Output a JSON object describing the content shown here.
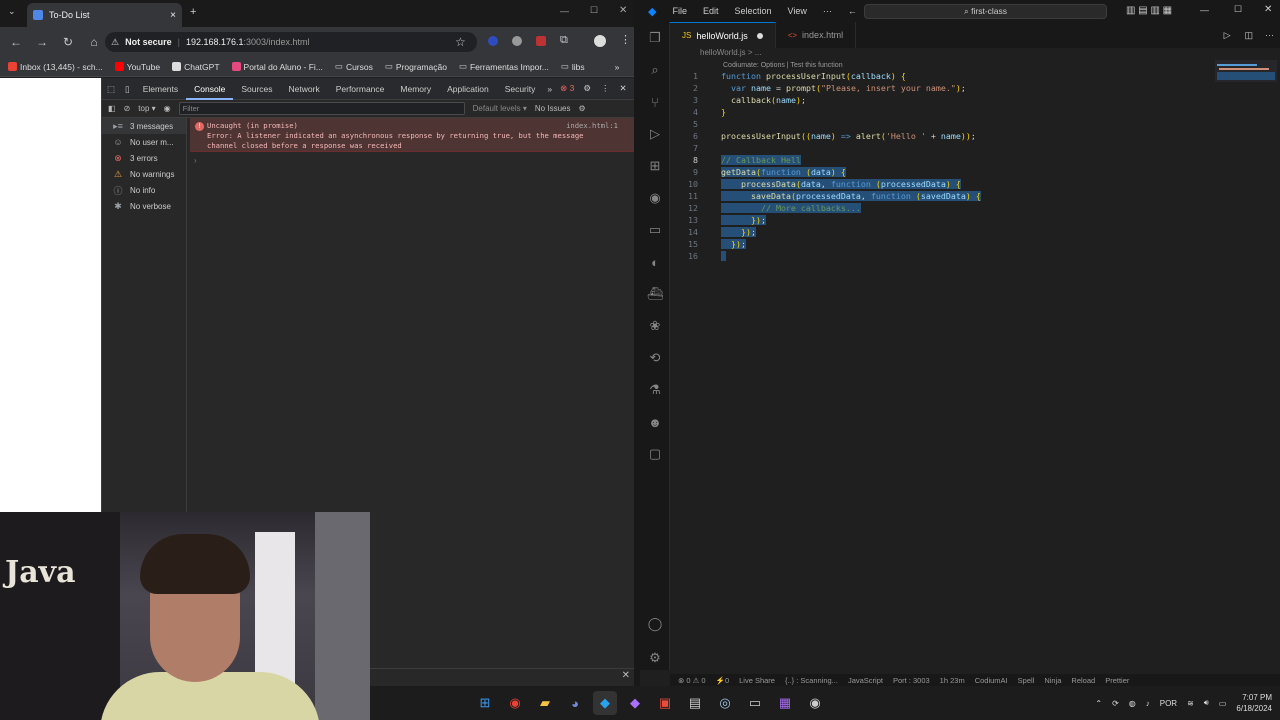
{
  "browser": {
    "tab_title": "To-Do List",
    "security_label": "Not secure",
    "url_host": "192.168.176.1",
    "url_rest": ":3003/index.html",
    "bookmarks": [
      "Inbox (13,445) - sch...",
      "YouTube",
      "ChatGPT",
      "Portal do Aluno - Fi...",
      "Cursos",
      "Programação",
      "Ferramentas Impor...",
      "libs"
    ]
  },
  "devtools": {
    "tabs": [
      "Elements",
      "Console",
      "Sources",
      "Network",
      "Performance",
      "Memory",
      "Application",
      "Security"
    ],
    "active_tab": "Console",
    "issue_count": "3",
    "context": "top",
    "filter_placeholder": "Filter",
    "levels": "Default levels",
    "issues": "No Issues",
    "sidebar": [
      {
        "label": "3 messages",
        "icon": "list-icon",
        "color": "#9aa0a6"
      },
      {
        "label": "No user m...",
        "icon": "user-icon",
        "color": "#9aa0a6"
      },
      {
        "label": "3 errors",
        "icon": "error-icon",
        "color": "#e46962"
      },
      {
        "label": "No warnings",
        "icon": "warning-icon",
        "color": "#f2a541"
      },
      {
        "label": "No info",
        "icon": "info-icon",
        "color": "#9aa0a6"
      },
      {
        "label": "No verbose",
        "icon": "bug-icon",
        "color": "#9aa0a6"
      }
    ],
    "error": {
      "line1": "Uncaught (in promise)",
      "line2": "Error: A listener indicated an asynchronous response by returning true, but the message",
      "line3": "channel closed before a response was received",
      "source": "index.html:1"
    }
  },
  "webcam": {
    "poster_text": "Java"
  },
  "vscode": {
    "menu": [
      "File",
      "Edit",
      "Selection",
      "View"
    ],
    "search": "first-class",
    "tabs": [
      {
        "name": "helloWorld.js",
        "active": true,
        "dirty": true
      },
      {
        "name": "index.html",
        "active": false,
        "dirty": false
      }
    ],
    "breadcrumb": "helloWorld.js > ...",
    "codelens": "Codiumate: Options | Test this function",
    "lines": [
      {
        "n": "1",
        "t": "function processUserInput(callback) {"
      },
      {
        "n": "2",
        "t": "  var name = prompt(\"Please, insert your name.\");"
      },
      {
        "n": "3",
        "t": "  callback(name);"
      },
      {
        "n": "4",
        "t": "}"
      },
      {
        "n": "5",
        "t": ""
      },
      {
        "n": "6",
        "t": "processUserInput((name) => alert('Hello ' + name));"
      },
      {
        "n": "7",
        "t": ""
      },
      {
        "n": "8",
        "t": "// Callback Hell"
      },
      {
        "n": "9",
        "t": "getData(function (data) {"
      },
      {
        "n": "10",
        "t": "    processData(data, function (processedData) {"
      },
      {
        "n": "11",
        "t": "      saveData(processedData, function (savedData) {"
      },
      {
        "n": "12",
        "t": "        // More callbacks..."
      },
      {
        "n": "13",
        "t": "      });"
      },
      {
        "n": "14",
        "t": "    });"
      },
      {
        "n": "15",
        "t": "  });"
      },
      {
        "n": "16",
        "t": ""
      }
    ],
    "status": [
      "⊗ 0 ⚠ 0",
      "⚡0",
      "Live Share",
      "{..} : Scanning...",
      "JavaScript",
      "Port : 3003",
      "1h 23m",
      "CodiumAI",
      "Spell",
      "Ninja",
      "Reload",
      "Prettier"
    ]
  },
  "taskbar": {
    "lang": "POR",
    "time": "7:07 PM",
    "date": "6/18/2024"
  }
}
